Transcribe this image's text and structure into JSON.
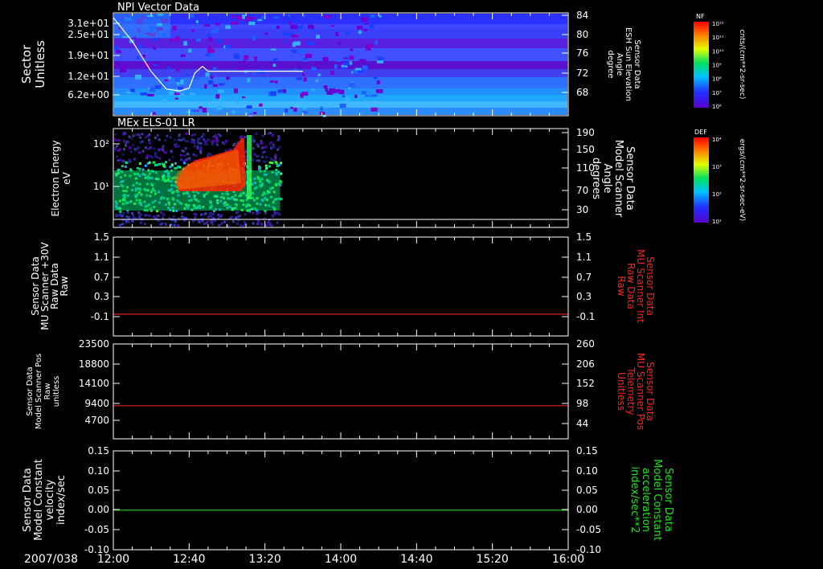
{
  "chart_data": [
    {
      "type": "heatmap",
      "title": "NPI Vector Data",
      "ylabel": [
        "Sector",
        "Unitless"
      ],
      "y_tick_labels": [
        "3.1e+01",
        "2.5e+01",
        "1.9e+01",
        "1.2e+01",
        "6.2e+00"
      ],
      "y2_tick_labels": [
        "84",
        "80",
        "76",
        "72",
        "68"
      ],
      "y2label": [
        "Sensor Data",
        "ESH Sun Elevation",
        "Angle",
        "degree"
      ],
      "overlay_series": {
        "x": [
          "12:00",
          "12:10",
          "12:20",
          "12:28",
          "12:35",
          "12:40",
          "12:43",
          "12:47",
          "12:50",
          "13:40"
        ],
        "y": [
          83.5,
          78.6,
          72.3,
          68.7,
          68.3,
          68.9,
          72.0,
          73.4,
          72.4,
          72.4
        ]
      },
      "colorbar": {
        "label": "NF",
        "units": "cnts/(cm**2-sr-sec)",
        "ticks": [
          "10¹²",
          "10¹¹",
          "10¹⁰",
          "10⁹",
          "10⁸",
          "10⁷",
          "10⁶"
        ]
      }
    },
    {
      "type": "heatmap",
      "title": "MEx ELS-01 LR",
      "ylabel": [
        "Electron Energy",
        "eV"
      ],
      "y_tick_labels": [
        "10²",
        "10¹"
      ],
      "y2_tick_labels": [
        "190",
        "150",
        "110",
        "70",
        "30"
      ],
      "y2label": [
        "Sensor Data",
        "Model Scanner",
        "Angle",
        "degrees"
      ],
      "data_end": "13:28",
      "colorbar": {
        "label": "DEF",
        "units": "ergs/(cm**2-sr-sec-eV)",
        "ticks": [
          "10⁴",
          "10³",
          "10²",
          "10¹"
        ]
      }
    },
    {
      "type": "line",
      "ylabel": [
        "Sensor Data",
        "MU Scanner +30V",
        "Raw Data",
        "Raw"
      ],
      "y_tick_labels": [
        "1.5",
        "1.1",
        "0.7",
        "0.3",
        "-0.1"
      ],
      "y2_tick_labels": [
        "1.5",
        "1.1",
        "0.7",
        "0.3",
        "-0.1"
      ],
      "y2label": [
        "Sensor Data",
        "MU Scanner Int",
        "Raw Data",
        "Raw"
      ],
      "series": [
        {
          "color": "#e02020",
          "value": -0.05
        }
      ]
    },
    {
      "type": "line",
      "ylabel": [
        "Sensor Data",
        "Model Scanner Pos",
        "Raw",
        "unitless"
      ],
      "y_tick_labels": [
        "23500",
        "18800",
        "14100",
        "9400",
        "4700"
      ],
      "y2_tick_labels": [
        "260",
        "206",
        "152",
        "98",
        "44"
      ],
      "y2label": [
        "Sensor Data",
        "MU Scanner Pos",
        "Telemetry",
        "Unitless"
      ],
      "series": [
        {
          "color": "#e02020",
          "value": 8300
        }
      ]
    },
    {
      "type": "line",
      "ylabel": [
        "Sensor Data",
        "Model Constant",
        "velocity",
        "index/sec"
      ],
      "y_tick_labels": [
        "0.15",
        "0.10",
        "0.05",
        "0.00",
        "-0.05",
        "-0.10"
      ],
      "y2_tick_labels": [
        "0.15",
        "0.10",
        "0.05",
        "0.00",
        "-0.05",
        "-0.10"
      ],
      "y2label": [
        "Sensor Data",
        "Model Constant",
        "acceleration",
        "index/sec**2"
      ],
      "series": [
        {
          "color": "#20d020",
          "value": 0.0
        }
      ]
    }
  ],
  "x_axis": {
    "date_label": "2007/038",
    "tick_labels": [
      "12:00",
      "12:40",
      "13:20",
      "14:00",
      "14:40",
      "15:20",
      "16:00"
    ],
    "start": "12:00",
    "end": "16:00"
  },
  "colors": {
    "axis": "#ffffff",
    "background": "#000000"
  }
}
